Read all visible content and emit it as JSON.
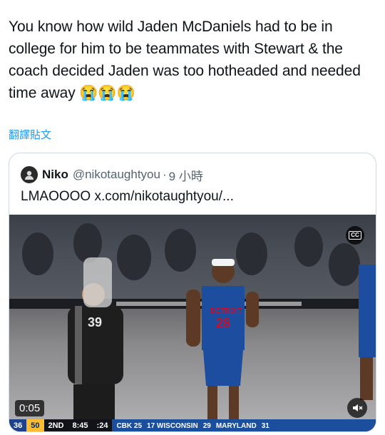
{
  "tweet": {
    "text": "You know how wild Jaden McDaniels had to be in college for him to be teammates with Stewart & the coach decided Jaden was too hotheaded and needed time away 😭😭😭",
    "translate_label": "翻譯貼文"
  },
  "quote": {
    "name": "Niko",
    "handle": "@nikotaughtyou",
    "dot": "·",
    "time": "9 小時",
    "text": "LMAOOOO x.com/nikotaughtyou/...",
    "avatar_icon": "avatar-icon"
  },
  "video": {
    "elapsed": "0:05",
    "cc_label": "CC",
    "mute_icon": "speaker-muted-icon",
    "scoreboard": {
      "team1_score": "36",
      "team2_score": "50",
      "period": "2ND",
      "clock": "8:45",
      "shot_clock": ":24",
      "ticker": [
        "CBK 25",
        "17 WISCONSIN",
        "29",
        "MARYLAND",
        "31"
      ]
    }
  },
  "colors": {
    "link": "#1d9bf0",
    "text": "#0f1419",
    "muted": "#536471",
    "border": "#cfd9de"
  }
}
